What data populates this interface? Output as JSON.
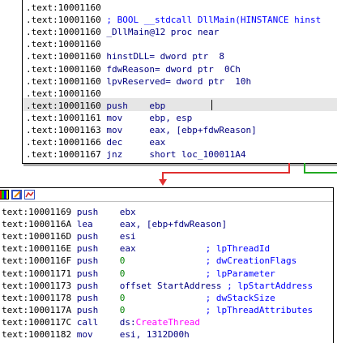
{
  "block1": {
    "lines": [
      {
        "addr": ".text:10001160",
        "text": ""
      },
      {
        "addr": ".text:10001160",
        "text": " ; BOOL __stdcall DllMain(HINSTANCE hinst"
      },
      {
        "addr": ".text:10001160",
        "text": " _DllMain@12 proc near"
      },
      {
        "addr": ".text:10001160",
        "text": ""
      },
      {
        "addr": ".text:10001160",
        "text": " hinstDLL= dword ptr  8"
      },
      {
        "addr": ".text:10001160",
        "text": " fdwReason= dword ptr  0Ch"
      },
      {
        "addr": ".text:10001160",
        "text": " lpvReserved= dword ptr  10h"
      },
      {
        "addr": ".text:10001160",
        "text": ""
      },
      {
        "addr": ".text:10001160",
        "text": " push    ebp"
      },
      {
        "addr": ".text:10001161",
        "text": " mov     ebp, esp"
      },
      {
        "addr": ".text:10001163",
        "text": " mov     eax, [ebp+fdwReason]"
      },
      {
        "addr": ".text:10001166",
        "text": " dec     eax"
      },
      {
        "addr": ".text:10001167",
        "text": " jnz     short loc_100011A4"
      }
    ]
  },
  "block2": {
    "lines": [
      {
        "addr": "text:10001169",
        "ins": " push    ",
        "ops": "ebx",
        "cmt": ""
      },
      {
        "addr": "text:1000116A",
        "ins": " lea     ",
        "ops": "eax, [ebp+fdwReason]",
        "cmt": ""
      },
      {
        "addr": "text:1000116D",
        "ins": " push    ",
        "ops": "esi",
        "cmt": ""
      },
      {
        "addr": "text:1000116E",
        "ins": " push    ",
        "ops": "eax             ",
        "cmt": "; lpThreadId"
      },
      {
        "addr": "text:1000116F",
        "ins": " push    ",
        "ops": "0               ",
        "cmt": "; dwCreationFlags"
      },
      {
        "addr": "text:10001171",
        "ins": " push    ",
        "ops": "0               ",
        "cmt": "; lpParameter"
      },
      {
        "addr": "text:10001173",
        "ins": " push    ",
        "ops": "offset StartAddress ",
        "cmt": "; lpStartAddress"
      },
      {
        "addr": "text:10001178",
        "ins": " push    ",
        "ops": "0               ",
        "cmt": "; dwStackSize"
      },
      {
        "addr": "text:1000117A",
        "ins": " push    ",
        "ops": "0               ",
        "cmt": "; lpThreadAttributes"
      },
      {
        "addr": "text:1000117C",
        "ins": " call    ",
        "ops": "ds:",
        "api": "CreateThread",
        "cmt": ""
      },
      {
        "addr": "text:10001182",
        "ins": " mov     ",
        "ops": "esi, 1312D00h",
        "cmt": ""
      }
    ]
  },
  "colors": {
    "text": "#000080",
    "comment": "#0000ff",
    "api": "#ff00ff",
    "false_edge": "#e03030",
    "true_edge": "#22aa22",
    "highlight": "#e6e6e6"
  },
  "icons": [
    "color-palette-icon",
    "edit-block-icon",
    "graph-view-icon"
  ]
}
